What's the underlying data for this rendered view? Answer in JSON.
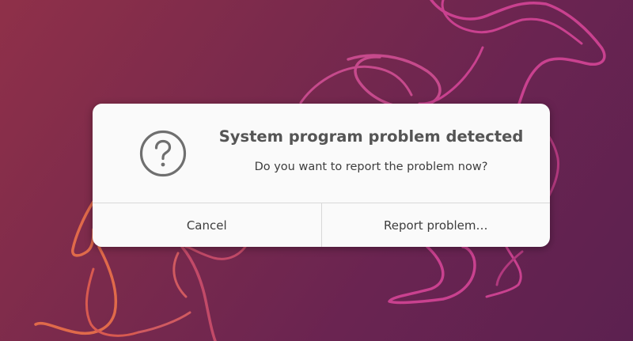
{
  "dialog": {
    "icon": "question-mark-icon",
    "title": "System program problem detected",
    "message": "Do you want to report the problem now?",
    "cancel_label": "Cancel",
    "report_label": "Report problem…"
  },
  "colors": {
    "wallpaper_start": "#8f3049",
    "wallpaper_end": "#5c2150",
    "dialog_background": "#fafafa",
    "title_text": "#555555",
    "body_text": "#3d3d3d"
  }
}
